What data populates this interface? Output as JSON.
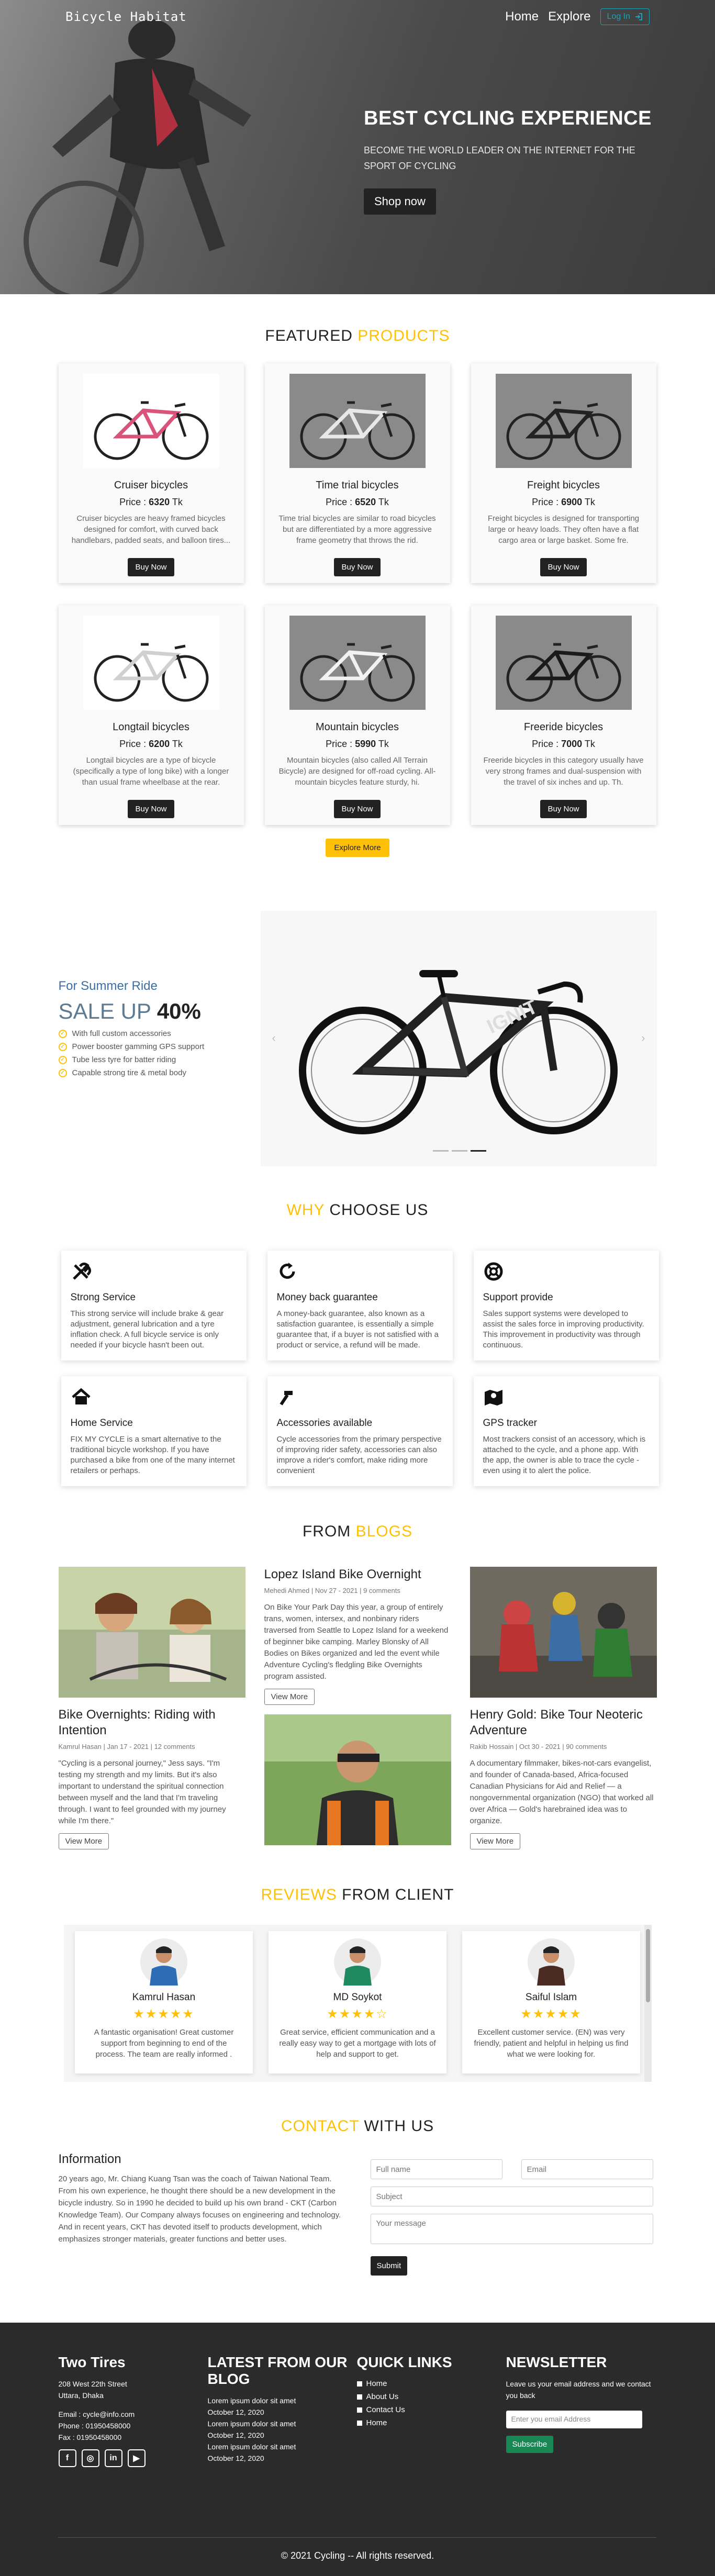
{
  "nav": {
    "brand": "Bicycle Habitat",
    "links": [
      "Home",
      "Explore"
    ],
    "login": "Log In",
    "login_icon": "login-icon"
  },
  "hero": {
    "title": "BEST CYCLING EXPERIENCE",
    "subtitle": "BECOME THE WORLD LEADER ON THE INTERNET FOR THE SPORT OF CYCLING",
    "button": "Shop now"
  },
  "products": {
    "title_a": "FEATURED",
    "title_b": "PRODUCTS",
    "items": [
      {
        "name": "Cruiser bicycles",
        "price_label": "Price :",
        "price": "6320",
        "currency": "Tk",
        "desc": "Cruiser bicycles are heavy framed bicycles designed for comfort, with curved back handlebars, padded seats, and balloon tires...",
        "button": "Buy Now",
        "color": "#d9537a"
      },
      {
        "name": "Time trial bicycles",
        "price_label": "Price :",
        "price": "6520",
        "currency": "Tk",
        "desc": "Time trial bicycles are similar to road bicycles but are differentiated by a more aggressive frame geometry that throws the rid.",
        "button": "Buy Now",
        "color": "#e8e8e8"
      },
      {
        "name": "Freight bicycles",
        "price_label": "Price :",
        "price": "6900",
        "currency": "Tk",
        "desc": "Freight bicycles is designed for transporting large or heavy loads. They often have a flat cargo area or large basket. Some fre.",
        "button": "Buy Now",
        "color": "#222222"
      },
      {
        "name": "Longtail bicycles",
        "price_label": "Price :",
        "price": "6200",
        "currency": "Tk",
        "desc": "Longtail bicycles are a type of bicycle (specifically a type of long bike) with a longer than usual frame wheelbase at the rear.",
        "button": "Buy Now",
        "color": "#d0d0d0"
      },
      {
        "name": "Mountain bicycles",
        "price_label": "Price :",
        "price": "5990",
        "currency": "Tk",
        "desc": "Mountain bicycles (also called All Terrain Bicycle) are designed for off-road cycling. All-mountain bicycles feature sturdy, hi.",
        "button": "Buy Now",
        "color": "#f2f2f2"
      },
      {
        "name": "Freeride bicycles",
        "price_label": "Price :",
        "price": "7000",
        "currency": "Tk",
        "desc": "Freeride bicycles in this category usually have very strong frames and dual-suspension with the travel of six inches and up. Th.",
        "button": "Buy Now",
        "color": "#1a1a1a"
      }
    ],
    "explore": "Explore More"
  },
  "sale": {
    "eyebrow": "For Summer Ride",
    "title": "SALE UP",
    "percent": "40%",
    "features": [
      "With full custom accessories",
      "Power booster gamming GPS support",
      "Tube less tyre for batter riding",
      "Capable strong tire & metal body"
    ]
  },
  "why": {
    "title_a": "WHY",
    "title_b": "CHOOSE US",
    "items": [
      {
        "name": "Strong Service",
        "icon": "tools-icon",
        "desc": "This strong service will include brake & gear adjustment, general lubrication and a tyre inflation check. A full bicycle service is only needed if your bicycle hasn't been out."
      },
      {
        "name": "Money back guarantee",
        "icon": "refresh-icon",
        "desc": "A money-back guarantee, also known as a satisfaction guarantee, is essentially a simple guarantee that, if a buyer is not satisfied with a product or service, a refund will be made."
      },
      {
        "name": "Support provide",
        "icon": "lifebuoy-icon",
        "desc": "Sales support systems were developed to assist the sales force in improving productivity. This improvement in productivity was through continuous."
      },
      {
        "name": "Home Service",
        "icon": "home-icon",
        "desc": "FIX MY CYCLE is a smart alternative to the traditional bicycle workshop. If you have purchased a bike from one of the many internet retailers or perhaps."
      },
      {
        "name": "Accessories available",
        "icon": "hammer-icon",
        "desc": "Cycle accessories from the primary perspective of improving rider safety, accessories can also improve a rider's comfort, make riding more convenient"
      },
      {
        "name": "GPS tracker",
        "icon": "map-icon",
        "desc": "Most trackers consist of an accessory, which is attached to the cycle, and a phone app. With the app, the owner is able to trace the cycle - even using it to alert the police."
      }
    ]
  },
  "blogs": {
    "title_a": "FROM",
    "title_b": "BLOGS",
    "items": [
      {
        "title": "Bike Overnights: Riding with Intention",
        "meta": "Kamrul Hasan | Jan 17 - 2021 | 12 comments",
        "text": "\"Cycling is a personal journey,\" Jess says. \"I'm testing my strength and my limits. But it's also important to understand the spiritual connection between myself and the land that I'm traveling through. I want to feel grounded with my journey while I'm there.\"",
        "button": "View More"
      },
      {
        "title": "Lopez Island Bike Overnight",
        "meta": "Mehedi Ahmed | Nov 27 - 2021 | 9 comments",
        "text": "On Bike Your Park Day this year, a group of entirely trans, women, intersex, and nonbinary riders traversed from Seattle to Lopez Island for a weekend of beginner bike camping. Marley Blonsky of All Bodies on Bikes organized and led the event while Adventure Cycling's fledgling Bike Overnights program assisted.",
        "button": "View More"
      },
      {
        "title": "Henry Gold: Bike Tour Neoteric Adventure",
        "meta": "Rakib Hossain | Oct 30 - 2021 | 90 comments",
        "text": "A documentary filmmaker, bikes-not-cars evangelist, and founder of Canada-based, Africa-focused Canadian Physicians for Aid and Relief — a nongovernmental organization (NGO) that worked all over Africa — Gold's harebrained idea was to organize.",
        "button": "View More"
      }
    ]
  },
  "reviews": {
    "title_a": "REVIEWS",
    "title_b": "FROM CLIENT",
    "items": [
      {
        "name": "Kamrul Hasan",
        "rating": 5,
        "stars": "★★★★★",
        "text": "A fantastic organisation! Great customer support from beginning to end of the process. The team are really informed .",
        "shirt": "#2d6db5"
      },
      {
        "name": "MD Soykot",
        "rating": 4,
        "stars": "★★★★☆",
        "text": "Great service, efficient communication and a really easy way to get a mortgage with lots of help and support to get.",
        "shirt": "#1f8a5f"
      },
      {
        "name": "Saiful Islam",
        "rating": 5,
        "stars": "★★★★★",
        "text": "Excellent customer service. (EN) was very friendly, patient and helpful in helping us find what we were looking for.",
        "shirt": "#4a2a22"
      }
    ]
  },
  "contact": {
    "title_a": "CONTACT",
    "title_b": "WITH US",
    "heading": "Information",
    "text": "20 years ago, Mr. Chiang Kuang Tsan was the coach of Taiwan National Team. From his own experience, he thought there should be a new development in the bicycle industry. So in 1990 he decided to build up his own brand - CKT (Carbon Knowledge Team). Our Company always focuses on engineering and technology. And in recent years, CKT has devoted itself to products development, which emphasizes stronger materials, greater functions and better uses.",
    "fullname_placeholder": "Full name",
    "email_placeholder": "Email",
    "subject_placeholder": "Subject",
    "message_placeholder": "Your message",
    "submit": "Submit"
  },
  "footer": {
    "brand": "Two Tires",
    "address_line1": "208 West 22th Street",
    "address_line2": "Uttara, Dhaka",
    "email": "Email : cycle@info.com",
    "phone": "Phone : 01950458000",
    "fax": "Fax : 01950458000",
    "social": [
      "facebook-icon",
      "instagram-icon",
      "linkedin-icon",
      "youtube-icon"
    ],
    "latest_title": "LATEST FROM OUR BLOG",
    "latest": [
      {
        "title": "Lorem ipsum dolor sit amet",
        "date": "October 12, 2020"
      },
      {
        "title": "Lorem ipsum dolor sit amet",
        "date": "October 12, 2020"
      },
      {
        "title": "Lorem ipsum dolor sit amet",
        "date": "October 12, 2020"
      }
    ],
    "quick_title": "QUICK LINKS",
    "quick": [
      "Home",
      "About Us",
      "Contact Us",
      "Home"
    ],
    "news_title": "NEWSLETTER",
    "news_text": "Leave us your email address and we contact you back",
    "news_placeholder": "Enter you email Address",
    "news_button": "Subscribe",
    "copyright": "2021 Cycling -- All rights reserved."
  }
}
